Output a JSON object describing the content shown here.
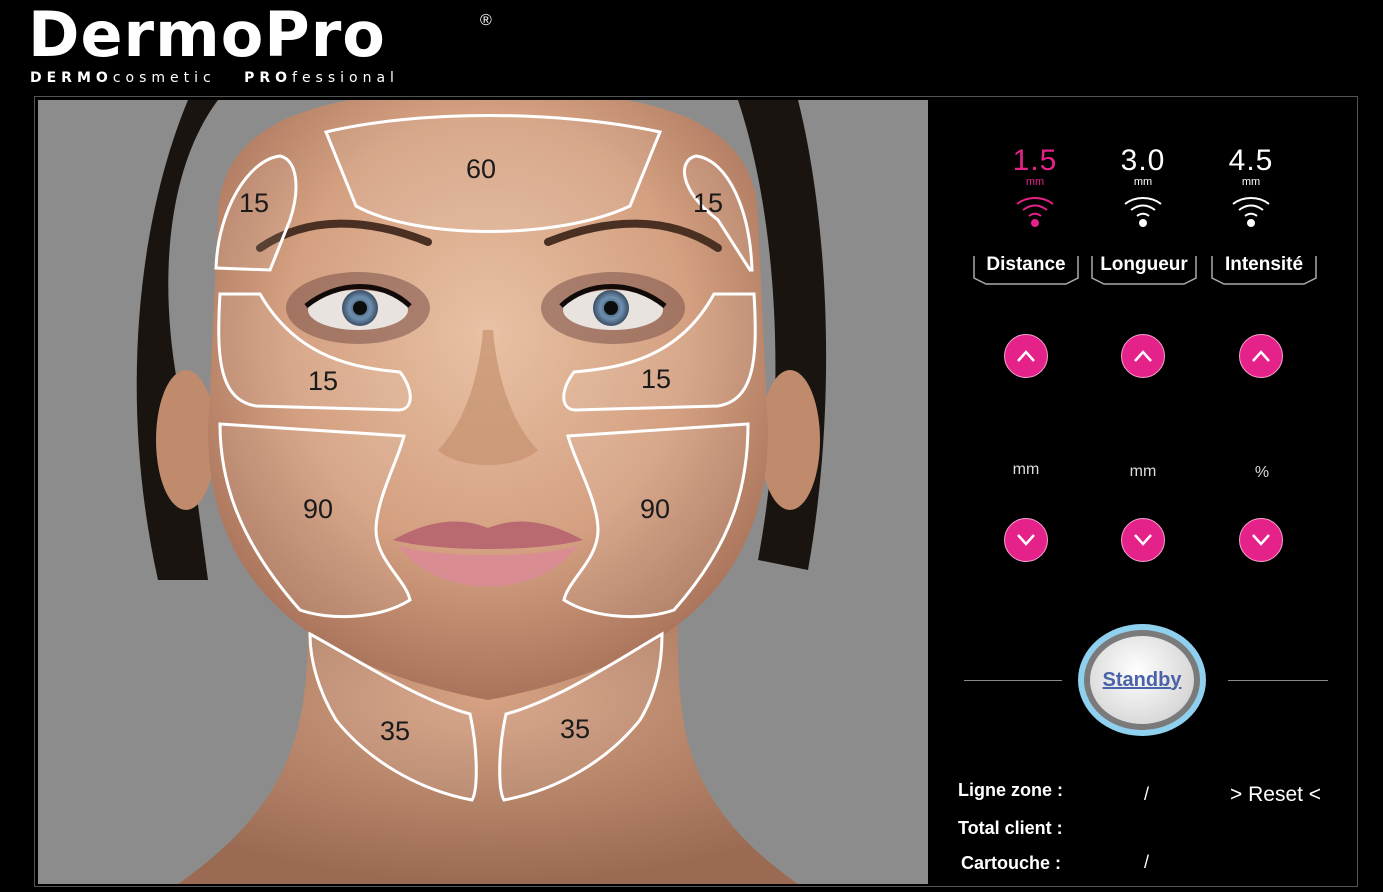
{
  "logo": {
    "main": "DermoPro",
    "reg": "®",
    "sub_bold1": "DERMO",
    "sub_light1": "cosmetic",
    "sub_bold2": "PRO",
    "sub_light2": "fessional"
  },
  "zones": [
    {
      "id": "forehead",
      "label": "60"
    },
    {
      "id": "temple-left",
      "label": "15"
    },
    {
      "id": "temple-right",
      "label": "15"
    },
    {
      "id": "under-eye-left",
      "label": "15"
    },
    {
      "id": "under-eye-right",
      "label": "15"
    },
    {
      "id": "cheek-left",
      "label": "90"
    },
    {
      "id": "cheek-right",
      "label": "90"
    },
    {
      "id": "neck-left",
      "label": "35"
    },
    {
      "id": "neck-right",
      "label": "35"
    }
  ],
  "settings": [
    {
      "value": "1.5",
      "unit": "mm",
      "tab": "Distance",
      "adjust_unit": "mm",
      "active": true
    },
    {
      "value": "3.0",
      "unit": "mm",
      "tab": "Longueur",
      "adjust_unit": "mm",
      "active": false
    },
    {
      "value": "4.5",
      "unit": "mm",
      "tab": "Intensité",
      "adjust_unit": "%",
      "active": false
    }
  ],
  "colors": {
    "accent": "#e5228a",
    "standby_ring": "#8fd0ee",
    "standby_text": "#4a62a8"
  },
  "standby_label": "Standby",
  "info": {
    "ligne_zone_label": "Ligne zone :",
    "ligne_zone_value": "/",
    "total_client_label": "Total client :",
    "cartouche_label": "Cartouche :",
    "cartouche_value": "/",
    "reset_label": "> Reset <"
  }
}
